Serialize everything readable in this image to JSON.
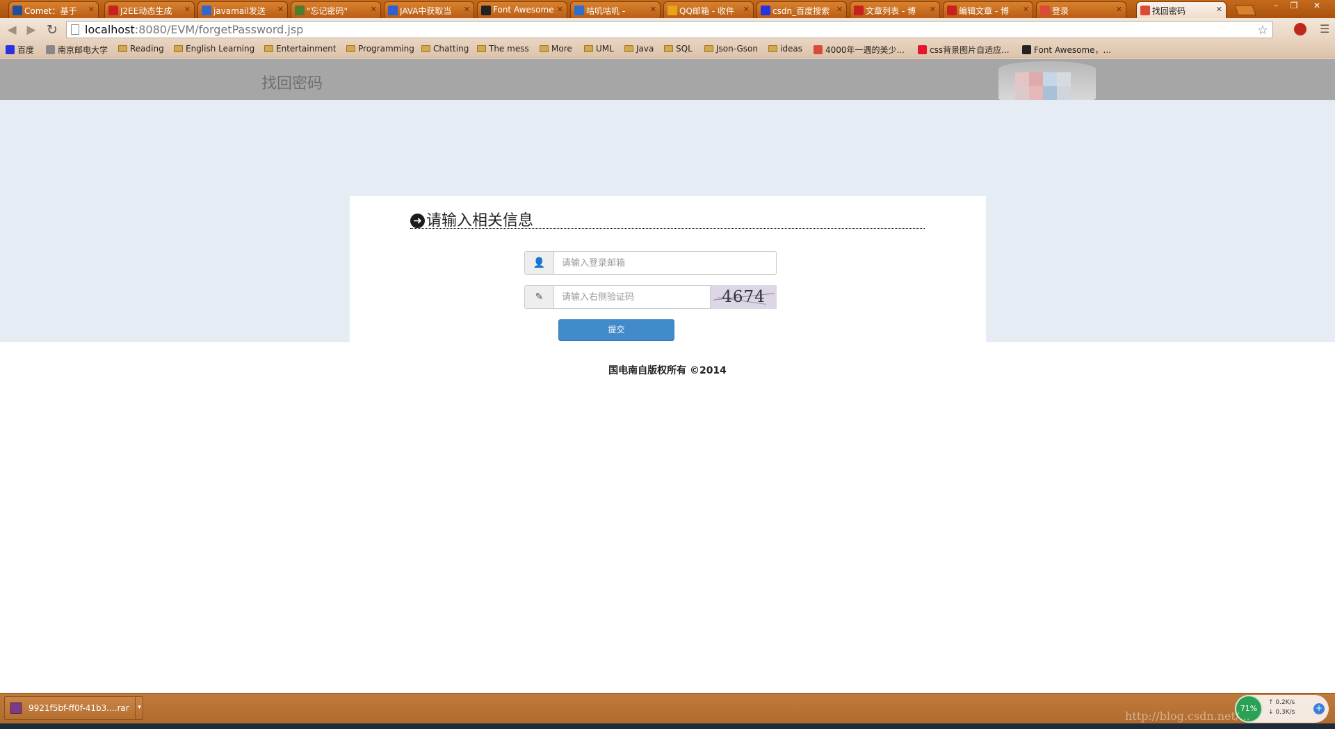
{
  "browser": {
    "tabs": [
      {
        "label": "Comet：基于",
        "favicon": "ibm-icon",
        "color": "#1f4e9c"
      },
      {
        "label": "J2EE动态生成",
        "favicon": "csdn-icon",
        "color": "#c8211d"
      },
      {
        "label": "javamail发送",
        "favicon": "google-icon",
        "color": "#3366cc"
      },
      {
        "label": "\"忘记密码\"",
        "favicon": "doc-icon",
        "color": "#4f7b2f"
      },
      {
        "label": "JAVA中获取当",
        "favicon": "baidu-icon",
        "color": "#2f5fd0"
      },
      {
        "label": "Font Awesome",
        "favicon": "flag-icon",
        "color": "#222222"
      },
      {
        "label": "咕叽咕叽 -",
        "favicon": "site-icon",
        "color": "#2a6fcf"
      },
      {
        "label": "QQ邮箱 - 收件",
        "favicon": "qqmail-icon",
        "color": "#e8a317"
      },
      {
        "label": "csdn_百度搜索",
        "favicon": "baidu-paw-icon",
        "color": "#2932e1"
      },
      {
        "label": "文章列表 - 博",
        "favicon": "csdn-icon",
        "color": "#c8211d"
      },
      {
        "label": "编辑文章 - 博",
        "favicon": "csdn-icon",
        "color": "#c8211d"
      },
      {
        "label": "登录",
        "favicon": "chart-icon",
        "color": "#d94a38"
      },
      {
        "label": "找回密码",
        "favicon": "chart-icon",
        "color": "#d94a38",
        "active": true
      }
    ],
    "url_host": "localhost",
    "url_path": ":8080/EVM/forgetPassword.jsp",
    "bookmarks": [
      {
        "label": "百度",
        "icon": "baidu-paw-icon"
      },
      {
        "label": "南京邮电大学",
        "icon": "page-icon"
      },
      {
        "label": "Reading",
        "icon": "folder-icon"
      },
      {
        "label": "English Learning",
        "icon": "folder-icon"
      },
      {
        "label": "Entertainment",
        "icon": "folder-icon"
      },
      {
        "label": "Programming",
        "icon": "folder-icon"
      },
      {
        "label": "Chatting",
        "icon": "folder-icon"
      },
      {
        "label": "The mess",
        "icon": "folder-icon"
      },
      {
        "label": "More",
        "icon": "folder-icon"
      },
      {
        "label": "UML",
        "icon": "folder-icon"
      },
      {
        "label": "Java",
        "icon": "folder-icon"
      },
      {
        "label": "SQL",
        "icon": "folder-icon"
      },
      {
        "label": "Json-Gson",
        "icon": "folder-icon"
      },
      {
        "label": "ideas",
        "icon": "folder-icon"
      },
      {
        "label": "4000年一遇的美少...",
        "icon": "chart-icon"
      },
      {
        "label": "css背景图片自适应...",
        "icon": "weibo-icon"
      },
      {
        "label": "Font Awesome，...",
        "icon": "flag-icon"
      }
    ]
  },
  "page": {
    "header_title": "找回密码",
    "form_heading": "请输入相关信息",
    "email_placeholder": "请输入登录邮箱",
    "captcha_placeholder": "请输入右侧验证码",
    "captcha_text": "4674",
    "submit_label": "提交",
    "footer": "国电南自版权所有 ©2014"
  },
  "shelf": {
    "download_name": "9921f5bf-ff0f-41b3....rar",
    "gauge_percent": "71%",
    "upload_speed": "0.2K/s",
    "download_speed": "0.3K/s",
    "watermark": "http://blog.csdn.net/..."
  },
  "colors": {
    "chrome_accent": "#b85d17",
    "header_gray": "#a6a6a6",
    "band_blue": "#e6ecf3",
    "primary_button": "#428bca"
  }
}
